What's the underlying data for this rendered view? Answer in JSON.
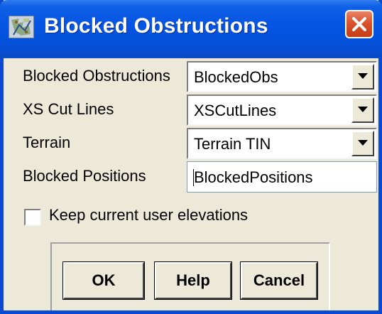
{
  "window": {
    "title": "Blocked Obstructions",
    "icon": "map-layer-icon",
    "close_icon": "close-icon",
    "titlebar_color": "#0554e3",
    "close_color": "#d9532b",
    "face_color": "#ece9d8"
  },
  "fields": {
    "blocked_obstructions": {
      "label": "Blocked Obstructions",
      "value": "BlockedObs"
    },
    "xs_cut_lines": {
      "label": "XS Cut Lines",
      "value": "XSCutLines"
    },
    "terrain": {
      "label": "Terrain",
      "value": "Terrain TIN"
    },
    "blocked_positions": {
      "label": "Blocked Positions",
      "value": "BlockedPositions"
    }
  },
  "options": {
    "keep_elevations": {
      "label": "Keep current user elevations",
      "checked": false
    }
  },
  "buttons": {
    "ok": "OK",
    "help": "Help",
    "cancel": "Cancel"
  }
}
